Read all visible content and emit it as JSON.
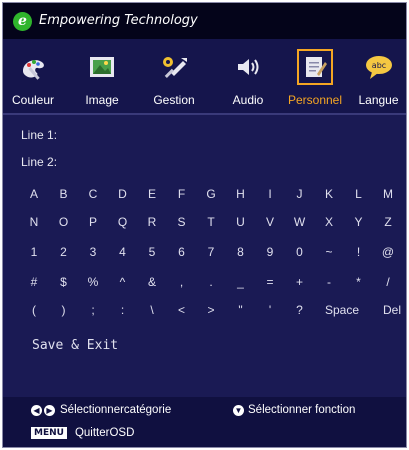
{
  "header": {
    "logo_letter": "e",
    "brand": "Empowering Technology"
  },
  "tabs": [
    {
      "label": "Couleur",
      "icon": "palette-icon"
    },
    {
      "label": "Image",
      "icon": "picture-icon"
    },
    {
      "label": "Gestion",
      "icon": "tools-icon"
    },
    {
      "label": "Audio",
      "icon": "speaker-icon"
    },
    {
      "label": "Personnel",
      "icon": "notepad-icon",
      "active": true
    },
    {
      "label": "Langue",
      "icon": "speech-bubble-icon"
    }
  ],
  "form": {
    "line1_label": "Line 1:",
    "line2_label": "Line 2:"
  },
  "keyboard": {
    "rows": [
      [
        "A",
        "B",
        "C",
        "D",
        "E",
        "F",
        "G",
        "H",
        "I",
        "J",
        "K",
        "L",
        "M"
      ],
      [
        "N",
        "O",
        "P",
        "Q",
        "R",
        "S",
        "T",
        "U",
        "V",
        "W",
        "X",
        "Y",
        "Z"
      ],
      [
        "1",
        "2",
        "3",
        "4",
        "5",
        "6",
        "7",
        "8",
        "9",
        "0",
        "~",
        "!",
        "@"
      ],
      [
        "#",
        "$",
        "%",
        "^",
        "&",
        ",",
        ".",
        "_",
        "=",
        "+",
        "-",
        "*",
        "/"
      ],
      [
        "(",
        ")",
        ";",
        ":",
        "\\",
        "<",
        ">",
        "\"",
        "'",
        "?",
        "Space",
        "Del"
      ]
    ],
    "save_exit": "Save & Exit"
  },
  "footer": {
    "select_category": "Sélectionnercatégorie",
    "select_function": "Sélectionner fonction",
    "menu_badge": "MENU",
    "quit": "QuitterOSD"
  },
  "colors": {
    "accent": "#f5a623",
    "background": "#1a1a54",
    "header": "#04041a"
  }
}
